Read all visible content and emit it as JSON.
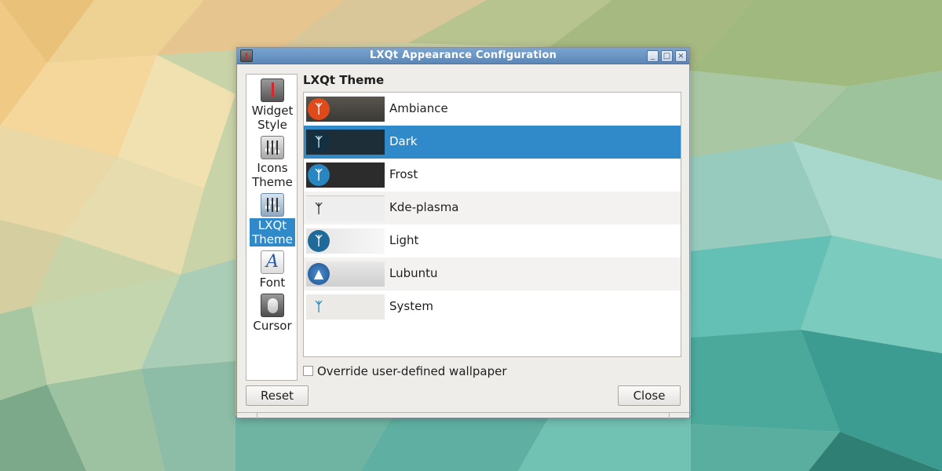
{
  "window": {
    "title": "LXQt Appearance Configuration",
    "buttons": {
      "minimize": "_",
      "maximize": "□",
      "close": "×"
    }
  },
  "sidebar": {
    "items": [
      {
        "label": "Widget Style",
        "icon": "widget-style-icon"
      },
      {
        "label": "Icons Theme",
        "icon": "icons-theme-icon"
      },
      {
        "label": "LXQt Theme",
        "icon": "lxqt-theme-icon",
        "selected": true
      },
      {
        "label": "Font",
        "icon": "font-icon",
        "glyph": "A"
      },
      {
        "label": "Cursor",
        "icon": "cursor-icon"
      }
    ]
  },
  "main": {
    "section_title": "LXQt Theme",
    "themes": [
      {
        "name": "Ambiance",
        "logo": "ᛉ"
      },
      {
        "name": "Dark",
        "logo": "ᛉ",
        "selected": true
      },
      {
        "name": "Frost",
        "logo": "ᛉ"
      },
      {
        "name": "Kde-plasma",
        "logo": "ᛉ"
      },
      {
        "name": "Light",
        "logo": "ᛉ"
      },
      {
        "name": "Lubuntu",
        "logo": "▲"
      },
      {
        "name": "System",
        "logo": "ᛉ"
      }
    ],
    "override_checkbox": {
      "label": "Override user-defined wallpaper",
      "checked": false
    }
  },
  "footer": {
    "reset_label": "Reset",
    "close_label": "Close"
  },
  "colors": {
    "selection": "#3089c8",
    "titlebar": "#6a94c4"
  }
}
